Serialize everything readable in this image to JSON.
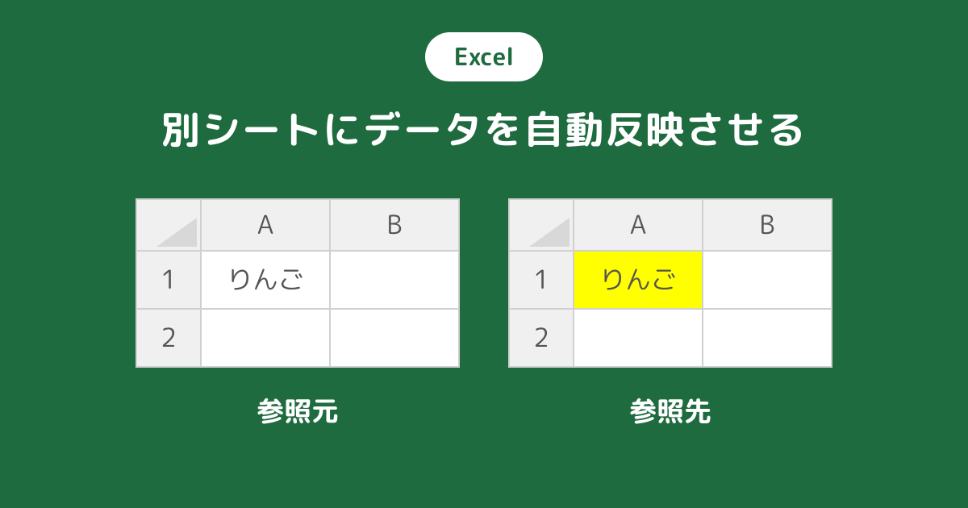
{
  "header": {
    "pill_label": "Excel",
    "title": "別シートにデータを自動反映させる"
  },
  "tables": {
    "left": {
      "label": "参照元",
      "columns": [
        "A",
        "B"
      ],
      "rows": [
        "1",
        "2"
      ],
      "cells": {
        "A1": "りんご",
        "B1": "",
        "A2": "",
        "B2": ""
      }
    },
    "right": {
      "label": "参照先",
      "columns": [
        "A",
        "B"
      ],
      "rows": [
        "1",
        "2"
      ],
      "cells": {
        "A1": "りんご",
        "B1": "",
        "A2": "",
        "B2": ""
      },
      "highlight_cell": "A1"
    }
  },
  "colors": {
    "background": "#1e6b3f",
    "highlight": "#ffff00",
    "header_bg": "#f0f0f0",
    "cell_border": "#d0d0d0"
  }
}
